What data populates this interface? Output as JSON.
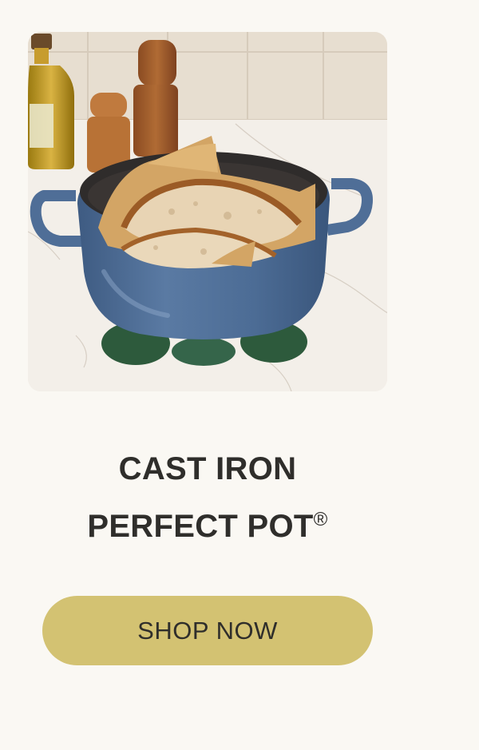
{
  "hero": {
    "image_alt": "Blue cast iron pot holding sliced sourdough bread on a marble countertop with green trivets, wooden pepper mills and olive oil bottle",
    "colors": {
      "pot": "#4F6E97",
      "trivet": "#2F5A3F",
      "wood": "#A5622E",
      "tile": "#E8DFD1",
      "marble": "#F2EEE8"
    }
  },
  "product": {
    "title_line1": "CAST IRON",
    "title_line2": "PERFECT POT",
    "title_mark": "®"
  },
  "cta": {
    "label": "SHOP NOW",
    "color": "#D3C272"
  }
}
